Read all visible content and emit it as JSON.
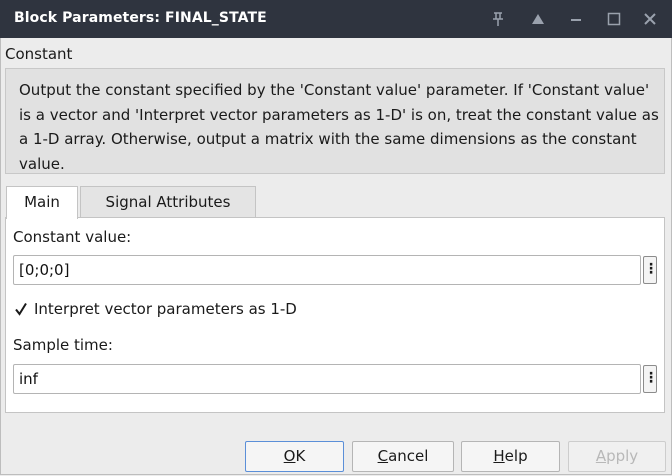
{
  "window": {
    "title": "Block Parameters: FINAL_STATE"
  },
  "block": {
    "type": "Constant",
    "description": "Output the constant specified by the 'Constant value' parameter. If 'Constant value' is a vector and 'Interpret vector parameters as 1-D' is on, treat the constant value as a 1-D array. Otherwise, output a matrix with the same dimensions as the constant value."
  },
  "tabs": [
    {
      "label": "Main",
      "active": true
    },
    {
      "label": "Signal Attributes",
      "active": false
    }
  ],
  "params": {
    "constant_label": "Constant value:",
    "constant_value": "[0;0;0]",
    "interpret_label": "Interpret vector parameters as 1-D",
    "interpret_checked": true,
    "sample_label": "Sample time:",
    "sample_value": "inf",
    "more_glyph": "⋮"
  },
  "buttons": {
    "ok": {
      "mnemonic": "O",
      "rest": "K"
    },
    "cancel": {
      "mnemonic": "C",
      "rest": "ancel"
    },
    "help": {
      "mnemonic": "H",
      "rest": "elp"
    },
    "apply": {
      "mnemonic": "A",
      "rest": "pply",
      "enabled": false
    }
  },
  "colors": {
    "titlebar": "#2f343f",
    "focus": "#5b8fd8"
  },
  "icons": [
    "pin-icon",
    "triangle-up-icon",
    "minimize-icon",
    "maximize-icon",
    "close-icon",
    "checkmark-icon"
  ]
}
